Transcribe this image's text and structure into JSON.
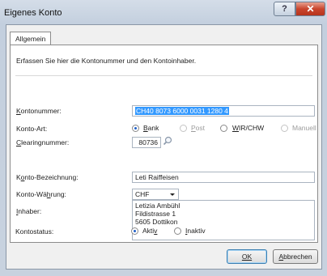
{
  "window": {
    "title": "Eigenes Konto",
    "help_label": "?",
    "close_label": "✕"
  },
  "tabs": [
    {
      "label": "Allgemein"
    }
  ],
  "info_text": "Erfassen Sie hier die Kontonummer und den Kontoinhaber.",
  "form": {
    "kontonummer": {
      "label": "Kontonummer:",
      "value": "CH40 8073 6000 0031 1280 4"
    },
    "kontoart": {
      "label": "Konto-Art:",
      "options": [
        {
          "label": "Bank",
          "checked": true,
          "enabled": true
        },
        {
          "label": "Post",
          "checked": false,
          "enabled": false
        },
        {
          "label": "WIR/CHW",
          "checked": false,
          "enabled": true
        },
        {
          "label": "Manuell",
          "checked": false,
          "enabled": false
        }
      ]
    },
    "clearing": {
      "label": "Clearingnummer:",
      "value": "80736"
    },
    "bezeichnung": {
      "label": "Konto-Bezeichnung:",
      "value": "Leti Raiffeisen"
    },
    "waehrung": {
      "label": "Konto-Währung:",
      "value": "CHF"
    },
    "inhaber": {
      "label": "Inhaber:",
      "lines": [
        "Letizia Ambühl",
        "Fildistrasse 1",
        "5605 Dottikon"
      ]
    },
    "status": {
      "label": "Kontostatus:",
      "options": [
        {
          "label": "Aktiv",
          "checked": true
        },
        {
          "label": "Inaktiv",
          "checked": false
        }
      ]
    }
  },
  "buttons": {
    "ok": "OK",
    "cancel": "Abbrechen"
  },
  "icons": {
    "lookup": "magnifier-icon"
  }
}
